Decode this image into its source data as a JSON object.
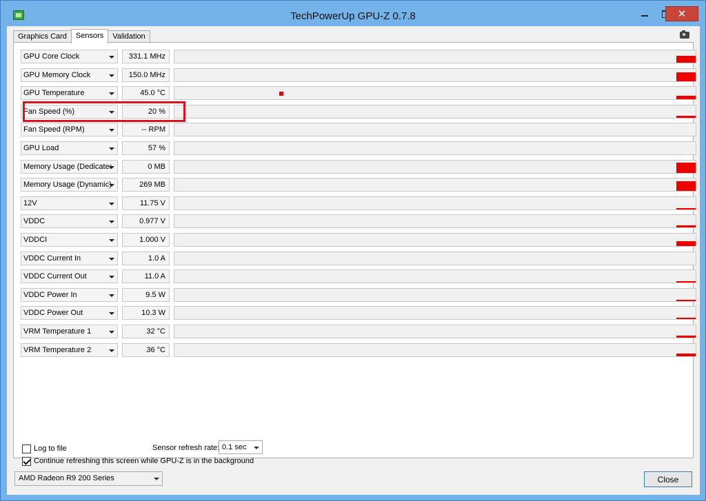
{
  "window": {
    "title": "TechPowerUp GPU-Z 0.7.8",
    "close_glyph": "✕"
  },
  "tabs": [
    {
      "label": "Graphics Card"
    },
    {
      "label": "Sensors"
    },
    {
      "label": "Validation"
    }
  ],
  "sensors": [
    {
      "name": "GPU Core Clock",
      "value": "331.1 MHz"
    },
    {
      "name": "GPU Memory Clock",
      "value": "150.0 MHz"
    },
    {
      "name": "GPU Temperature",
      "value": "45.0 °C"
    },
    {
      "name": "Fan Speed (%)",
      "value": "20 %"
    },
    {
      "name": "Fan Speed (RPM)",
      "value": "-- RPM"
    },
    {
      "name": "GPU Load",
      "value": "57 %"
    },
    {
      "name": "Memory Usage (Dedicated)",
      "value": "0 MB"
    },
    {
      "name": "Memory Usage (Dynamic)",
      "value": "269 MB"
    },
    {
      "name": "12V",
      "value": "11.75 V"
    },
    {
      "name": "VDDC",
      "value": "0.977 V"
    },
    {
      "name": "VDDCI",
      "value": "1.000 V"
    },
    {
      "name": "VDDC Current In",
      "value": "1.0 A"
    },
    {
      "name": "VDDC Current Out",
      "value": "11.0 A"
    },
    {
      "name": "VDDC Power In",
      "value": "9.5 W"
    },
    {
      "name": "VDDC Power Out",
      "value": "10.3 W"
    },
    {
      "name": "VRM Temperature 1",
      "value": "32 °C"
    },
    {
      "name": "VRM Temperature 2",
      "value": "36 °C"
    }
  ],
  "graph_levels": [
    0.55,
    0.7,
    0.25,
    0.15,
    0,
    0,
    0.85,
    0.75,
    0.1,
    0.15,
    0.4,
    0,
    0.05,
    0.1,
    0.1,
    0.15,
    0.2
  ],
  "options": {
    "log_to_file_label": "Log to file",
    "log_to_file_checked": false,
    "refresh_label": "Sensor refresh rate:",
    "refresh_value": "0.1 sec",
    "background_label": "Continue refreshing this screen while GPU-Z is in the background",
    "background_checked": true
  },
  "footer": {
    "gpu_selected": "AMD Radeon R9 200 Series",
    "close_label": "Close"
  },
  "colors": {
    "graph": "#ee0000",
    "highlight": "#e0101b"
  }
}
